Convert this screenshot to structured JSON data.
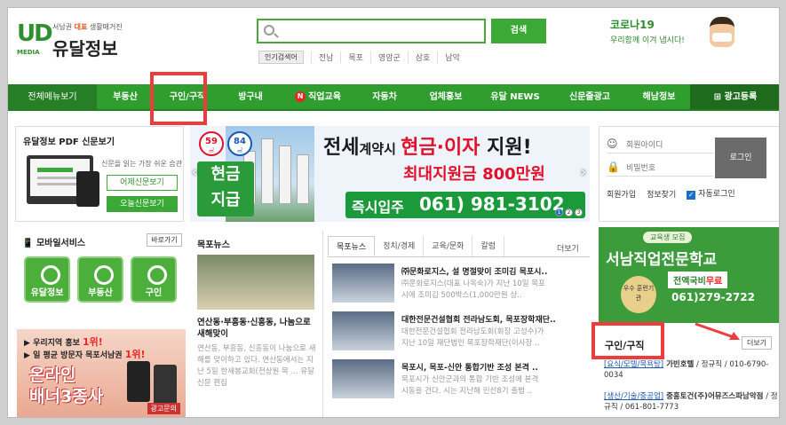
{
  "header": {
    "logo_mark": "UD",
    "logo_media": "MEDIA",
    "logo_tag_pre": "서남권 ",
    "logo_tag_em": "대표",
    "logo_tag_post": " 생활매거진",
    "logo_name": "유달정보",
    "search_placeholder": "",
    "search_button": "검색",
    "popular_label": "인기검색어",
    "popular_keywords": [
      "전남",
      "목포",
      "영암군",
      "삼호",
      "남악"
    ],
    "corona_title": "코로나19",
    "corona_sub": "우리함께 이겨 냅시다!"
  },
  "nav": {
    "items": [
      "전체메뉴보기",
      "부동산",
      "구인/구직",
      "방구내",
      "직업교육",
      "자동차",
      "업체홍보",
      "유달 NEWS",
      "신문줄광고",
      "해남정보",
      "광고등록"
    ],
    "new_badge": "N"
  },
  "pdf": {
    "title": "유달정보 PDF 신문보기",
    "tagline": "신문을 읽는 가장 쉬운 습관",
    "yesterday": "어제신문보기",
    "today": "오늘신문보기"
  },
  "main_banner": {
    "c1_num": "59",
    "c1_unit": "㎡",
    "c2_num": "84",
    "c2_unit": "㎡",
    "cash_1": "현금",
    "cash_2": "지급",
    "title_pre": "전세",
    "title_small": "계약시 ",
    "title_red": "현금·이자",
    "title_post": " 지원!",
    "subtitle": "최대지원금 800만원",
    "move": "즉시입주",
    "phone": "061) 981-3102",
    "dots": [
      "1",
      "2",
      "3"
    ]
  },
  "login": {
    "id_placeholder": "회원아이디",
    "pw_placeholder": "비밀번호",
    "login_button": "로그인",
    "signup": "회원가입",
    "find": "정보찾기",
    "auto": "자동로그인"
  },
  "mobile": {
    "title": "모바일서비스",
    "shortcut": "바로가기",
    "icons": [
      "유달정보",
      "부동산",
      "구인"
    ]
  },
  "online_ad": {
    "line1_pre": "우리지역 홍보 ",
    "line1_em": "1위!",
    "line2_pre": "일 평균 방문자 목포서남권 ",
    "line2_em": "1위!",
    "big1": "온라인",
    "big2": "배너3종사",
    "inquiry": "광고문의"
  },
  "mokpo_news": {
    "title": "목포뉴스",
    "headline": "연산동·부흥동·신흥동, 나눔으로 새해맞이",
    "summary": "연산동, 부흥동, 신흥동이 나눔으로 새해를 맞이하고 있다. 연산동에서는 지난 5일 한새봉교회(전상원 목 ... 유달신문 편집"
  },
  "news_tabs": {
    "tabs": [
      "목포뉴스",
      "정치/경제",
      "교육/문화",
      "칼럼"
    ],
    "more": "더보기",
    "items": [
      {
        "title": "㈜문화로지스, 설 명절맞이 조미김 목포시..",
        "desc1": "㈜문화로지스(대표 나옥숙)가 지난 10일 목포",
        "desc2": "시에 조미김 500박스(1,000만원 상.."
      },
      {
        "title": "대한전문건설협회 전라남도회, 목포장학재단..",
        "desc1": "대한전문건설협회 전라남도회(회장 고성수)가",
        "desc2": "지난 10일 재단법인 목포장학재단(이사장 .."
      },
      {
        "title": "목포시, 목포-신안 통합기반 조성 본격 ..",
        "desc1": "목포시가 신안군과의 통합 기반 조성에 본격",
        "desc2": "시동을 건다. 시는 지난해 민선8기 출범 .."
      }
    ]
  },
  "school_ad": {
    "pill": "교육생 모집",
    "name": "서남직업전문학교",
    "sub_pre": "전액",
    "sub_em": "국비",
    "sub_post": "무료",
    "phone": "061)279-2722",
    "badge": "우수 훈련기관"
  },
  "jobs": {
    "title": "구인/구직",
    "more": "더보기",
    "rows": [
      {
        "cat": "[요식/모텔/목욕탕]",
        "company": " 가빈호텔",
        "rest": " / 정규직 / 010-6790-0034"
      },
      {
        "cat": "[생산/기술/중공업]",
        "company": " 중흥토건(주)어뮤즈스파남악점",
        "rest": " / 정규직 / 061-801-7773"
      }
    ]
  },
  "colors": {
    "brand_green": "#2f9e2f",
    "highlight_red": "#ee3b3b"
  }
}
